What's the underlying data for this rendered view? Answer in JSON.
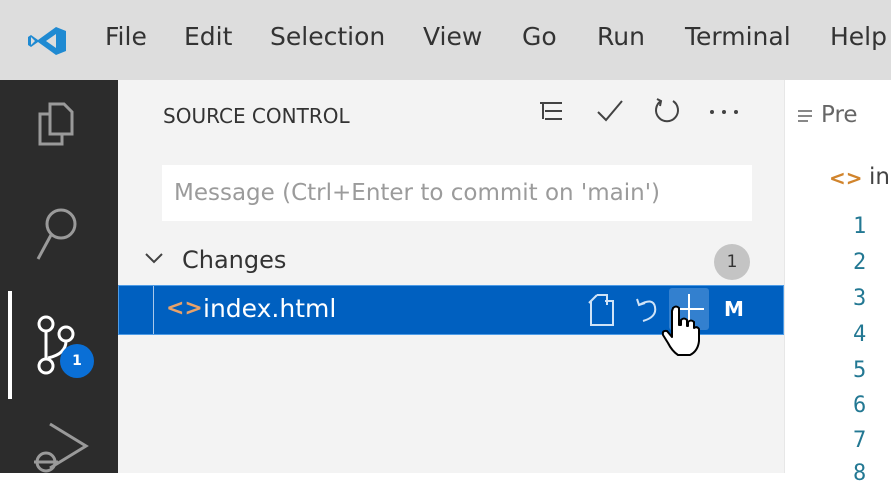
{
  "menubar": {
    "items": [
      "File",
      "Edit",
      "Selection",
      "View",
      "Go",
      "Run",
      "Terminal",
      "Help"
    ],
    "brand_color": "#0a6fd6"
  },
  "activity_bar": {
    "icons": [
      "explorer-icon",
      "search-icon",
      "source-control-icon",
      "run-debug-icon"
    ],
    "source_control_badge": "1"
  },
  "source_control": {
    "title": "SOURCE CONTROL",
    "title_actions": [
      "tree-view-icon",
      "commit-check-icon",
      "refresh-icon",
      "more-actions-icon"
    ],
    "commit_placeholder": "Message (Ctrl+Enter to commit on 'main')",
    "commit_value": "",
    "changes": {
      "label": "Changes",
      "count": "1",
      "files": [
        {
          "icon": "html-file-icon",
          "name": "index.html",
          "status": "M",
          "actions": [
            "open-file-icon",
            "discard-changes-icon",
            "stage-changes-icon"
          ]
        }
      ]
    }
  },
  "editor": {
    "tab_label": "Pre",
    "breadcrumb": "in",
    "line_numbers": [
      "1",
      "2",
      "3",
      "4",
      "5",
      "6",
      "7",
      "8"
    ]
  },
  "colors": {
    "selection": "#0060c0",
    "activity_bar": "#2c2c2c",
    "badge": "#0a6fd6"
  }
}
